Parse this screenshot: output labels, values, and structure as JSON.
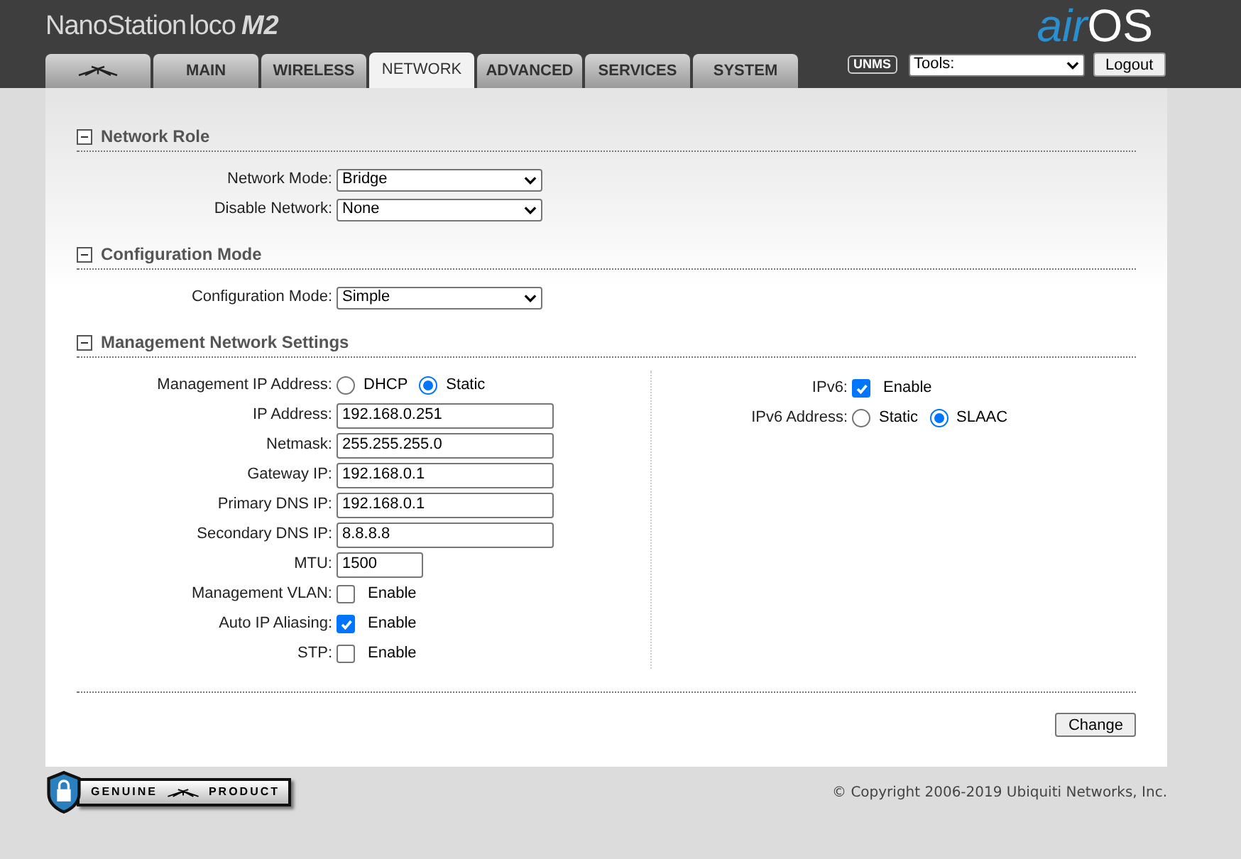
{
  "header": {
    "product_name": "NanoStation",
    "product_model": "loco",
    "product_version": "M2",
    "logo_prefix": "air",
    "logo_suffix": "OS"
  },
  "tabs": [
    {
      "kind": "icon",
      "selected": false
    },
    {
      "kind": "text",
      "label": "MAIN",
      "selected": false
    },
    {
      "kind": "text",
      "label": "WIRELESS",
      "selected": false
    },
    {
      "kind": "text",
      "label": "NETWORK",
      "selected": true
    },
    {
      "kind": "text",
      "label": "ADVANCED",
      "selected": false
    },
    {
      "kind": "text",
      "label": "SERVICES",
      "selected": false
    },
    {
      "kind": "text",
      "label": "SYSTEM",
      "selected": false
    }
  ],
  "toolbar": {
    "unms": "UNMS",
    "tools": "Tools:",
    "logout": "Logout"
  },
  "sections": [
    {
      "title": "Network Role",
      "expanded": true,
      "columns": [
        [
          {
            "kind": "select",
            "label": "Network Mode:",
            "value": "Bridge"
          },
          {
            "kind": "select",
            "label": "Disable Network:",
            "value": "None"
          }
        ]
      ]
    },
    {
      "title": "Configuration Mode",
      "expanded": true,
      "columns": [
        [
          {
            "kind": "select",
            "label": "Configuration Mode:",
            "value": "Simple"
          }
        ]
      ]
    },
    {
      "title": "Management Network Settings",
      "expanded": true,
      "columns": [
        [
          {
            "kind": "radio",
            "label": "Management IP Address:",
            "options": [
              {
                "label": "DHCP",
                "selected": false
              },
              {
                "label": "Static",
                "selected": true
              }
            ]
          },
          {
            "kind": "text",
            "label": "IP Address:",
            "value": "192.168.0.251"
          },
          {
            "kind": "text",
            "label": "Netmask:",
            "value": "255.255.255.0"
          },
          {
            "kind": "text",
            "label": "Gateway IP:",
            "value": "192.168.0.1"
          },
          {
            "kind": "text",
            "label": "Primary DNS IP:",
            "value": "192.168.0.1"
          },
          {
            "kind": "text",
            "label": "Secondary DNS IP:",
            "value": "8.8.8.8"
          },
          {
            "kind": "number",
            "label": "MTU:",
            "value": "1500"
          },
          {
            "kind": "checkbox",
            "label": "Management VLAN:",
            "option": "Enable",
            "checked": false
          },
          {
            "kind": "checkbox",
            "label": "Auto IP Aliasing:",
            "option": "Enable",
            "checked": true
          },
          {
            "kind": "checkbox",
            "label": "STP:",
            "option": "Enable",
            "checked": false
          }
        ],
        [
          {
            "kind": "checkbox",
            "label": "IPv6:",
            "option": "Enable",
            "checked": true
          },
          {
            "kind": "radio",
            "label": "IPv6 Address:",
            "options": [
              {
                "label": "Static",
                "selected": false
              },
              {
                "label": "SLAAC",
                "selected": true
              }
            ]
          }
        ]
      ]
    }
  ],
  "change_button": "Change",
  "footer": {
    "badge_left": "GENUINE",
    "badge_right": "PRODUCT",
    "copyright": "© Copyright 2006-2019 Ubiquiti Networks, Inc."
  }
}
